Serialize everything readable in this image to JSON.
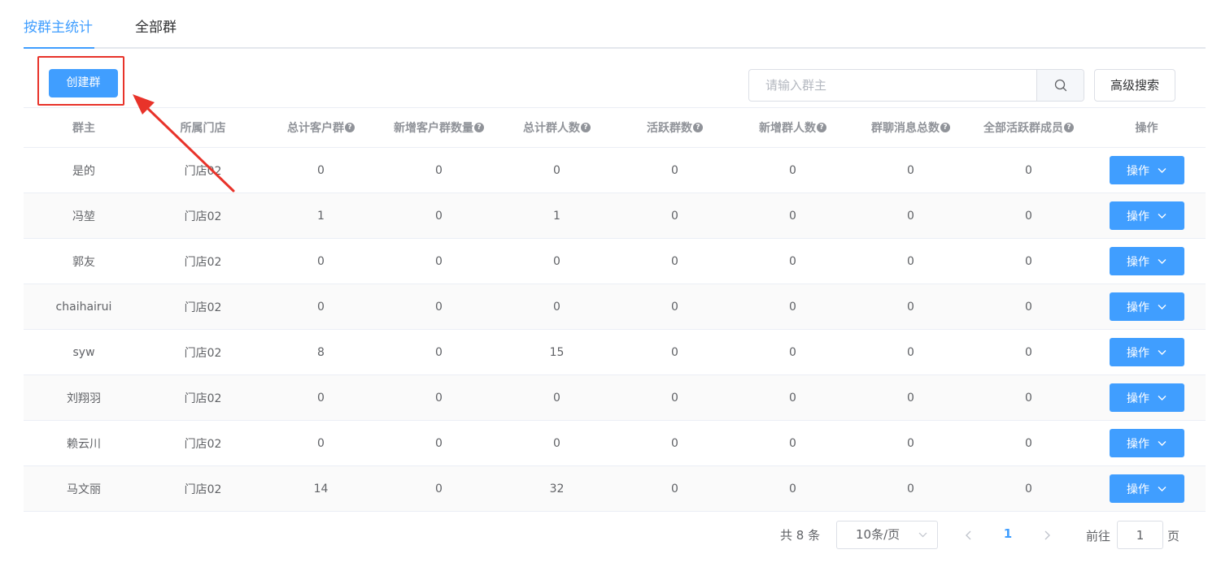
{
  "tabs": [
    {
      "label": "按群主统计",
      "active": true
    },
    {
      "label": "全部群",
      "active": false
    }
  ],
  "toolbar": {
    "create_label": "创建群",
    "search_placeholder": "请输入群主",
    "advanced_label": "高级搜索"
  },
  "table": {
    "headers": [
      "群主",
      "所属门店",
      "总计客户群",
      "新增客户群数量",
      "总计群人数",
      "活跃群数",
      "新增群人数",
      "群聊消息总数",
      "全部活跃群成员",
      "操作"
    ],
    "rows": [
      {
        "owner": "是的",
        "store": "门店02",
        "total_groups": "0",
        "new_groups": "0",
        "total_members": "0",
        "active_groups": "0",
        "new_members": "0",
        "messages": "0",
        "active_members": "0",
        "action": "操作"
      },
      {
        "owner": "冯堃",
        "store": "门店02",
        "total_groups": "1",
        "new_groups": "0",
        "total_members": "1",
        "active_groups": "0",
        "new_members": "0",
        "messages": "0",
        "active_members": "0",
        "action": "操作"
      },
      {
        "owner": "郭友",
        "store": "门店02",
        "total_groups": "0",
        "new_groups": "0",
        "total_members": "0",
        "active_groups": "0",
        "new_members": "0",
        "messages": "0",
        "active_members": "0",
        "action": "操作"
      },
      {
        "owner": "chaihairui",
        "store": "门店02",
        "total_groups": "0",
        "new_groups": "0",
        "total_members": "0",
        "active_groups": "0",
        "new_members": "0",
        "messages": "0",
        "active_members": "0",
        "action": "操作"
      },
      {
        "owner": "syw",
        "store": "门店02",
        "total_groups": "8",
        "new_groups": "0",
        "total_members": "15",
        "active_groups": "0",
        "new_members": "0",
        "messages": "0",
        "active_members": "0",
        "action": "操作"
      },
      {
        "owner": "刘翔羽",
        "store": "门店02",
        "total_groups": "0",
        "new_groups": "0",
        "total_members": "0",
        "active_groups": "0",
        "new_members": "0",
        "messages": "0",
        "active_members": "0",
        "action": "操作"
      },
      {
        "owner": "赖云川",
        "store": "门店02",
        "total_groups": "0",
        "new_groups": "0",
        "total_members": "0",
        "active_groups": "0",
        "new_members": "0",
        "messages": "0",
        "active_members": "0",
        "action": "操作"
      },
      {
        "owner": "马文丽",
        "store": "门店02",
        "total_groups": "14",
        "new_groups": "0",
        "total_members": "32",
        "active_groups": "0",
        "new_members": "0",
        "messages": "0",
        "active_members": "0",
        "action": "操作"
      }
    ]
  },
  "pagination": {
    "total_label": "共 8 条",
    "page_size": "10条/页",
    "current_page": "1",
    "goto_prefix": "前往",
    "goto_value": "1",
    "goto_suffix": "页"
  },
  "colors": {
    "primary": "#409eff",
    "annotation": "#e8332a"
  }
}
